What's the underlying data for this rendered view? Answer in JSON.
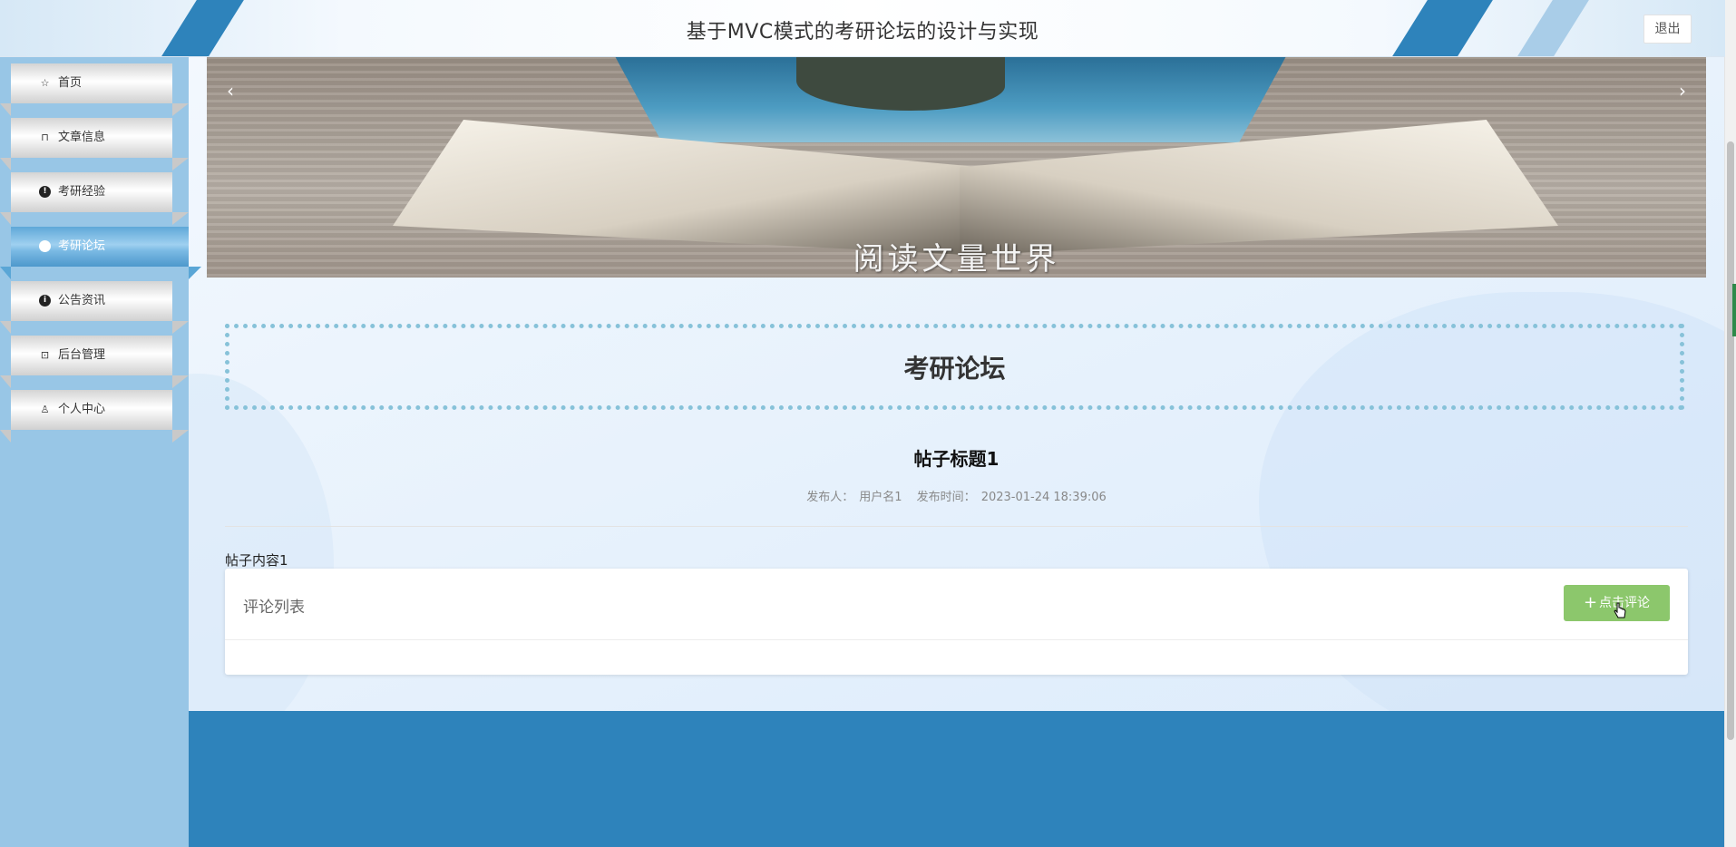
{
  "header": {
    "title": "基于MVC模式的考研论坛的设计与实现",
    "logout_label": "退出"
  },
  "sidebar": {
    "items": [
      {
        "label": "首页",
        "icon": "star-outline-icon",
        "active": false
      },
      {
        "label": "文章信息",
        "icon": "bag-icon",
        "active": false
      },
      {
        "label": "考研经验",
        "icon": "exclamation-circle-icon",
        "active": false
      },
      {
        "label": "考研论坛",
        "icon": "circle-icon",
        "active": true
      },
      {
        "label": "公告资讯",
        "icon": "info-circle-icon",
        "active": false
      },
      {
        "label": "后台管理",
        "icon": "briefcase-icon",
        "active": false
      },
      {
        "label": "个人中心",
        "icon": "user-icon",
        "active": false
      }
    ]
  },
  "banner": {
    "caption": "阅读文量世界"
  },
  "section": {
    "title": "考研论坛"
  },
  "post": {
    "title": "帖子标题1",
    "publisher_label": "发布人：",
    "publisher": "用户名1",
    "time_label": "发布时间：",
    "time": "2023-01-24 18:39:06",
    "content": "帖子内容1"
  },
  "comments": {
    "title": "评论列表",
    "button_label": "点击评论"
  },
  "colors": {
    "primary": "#2e83bb",
    "sidebar": "#98c6e6",
    "active_nav": "#5aa6d6",
    "comment_button": "#8cc76c"
  }
}
